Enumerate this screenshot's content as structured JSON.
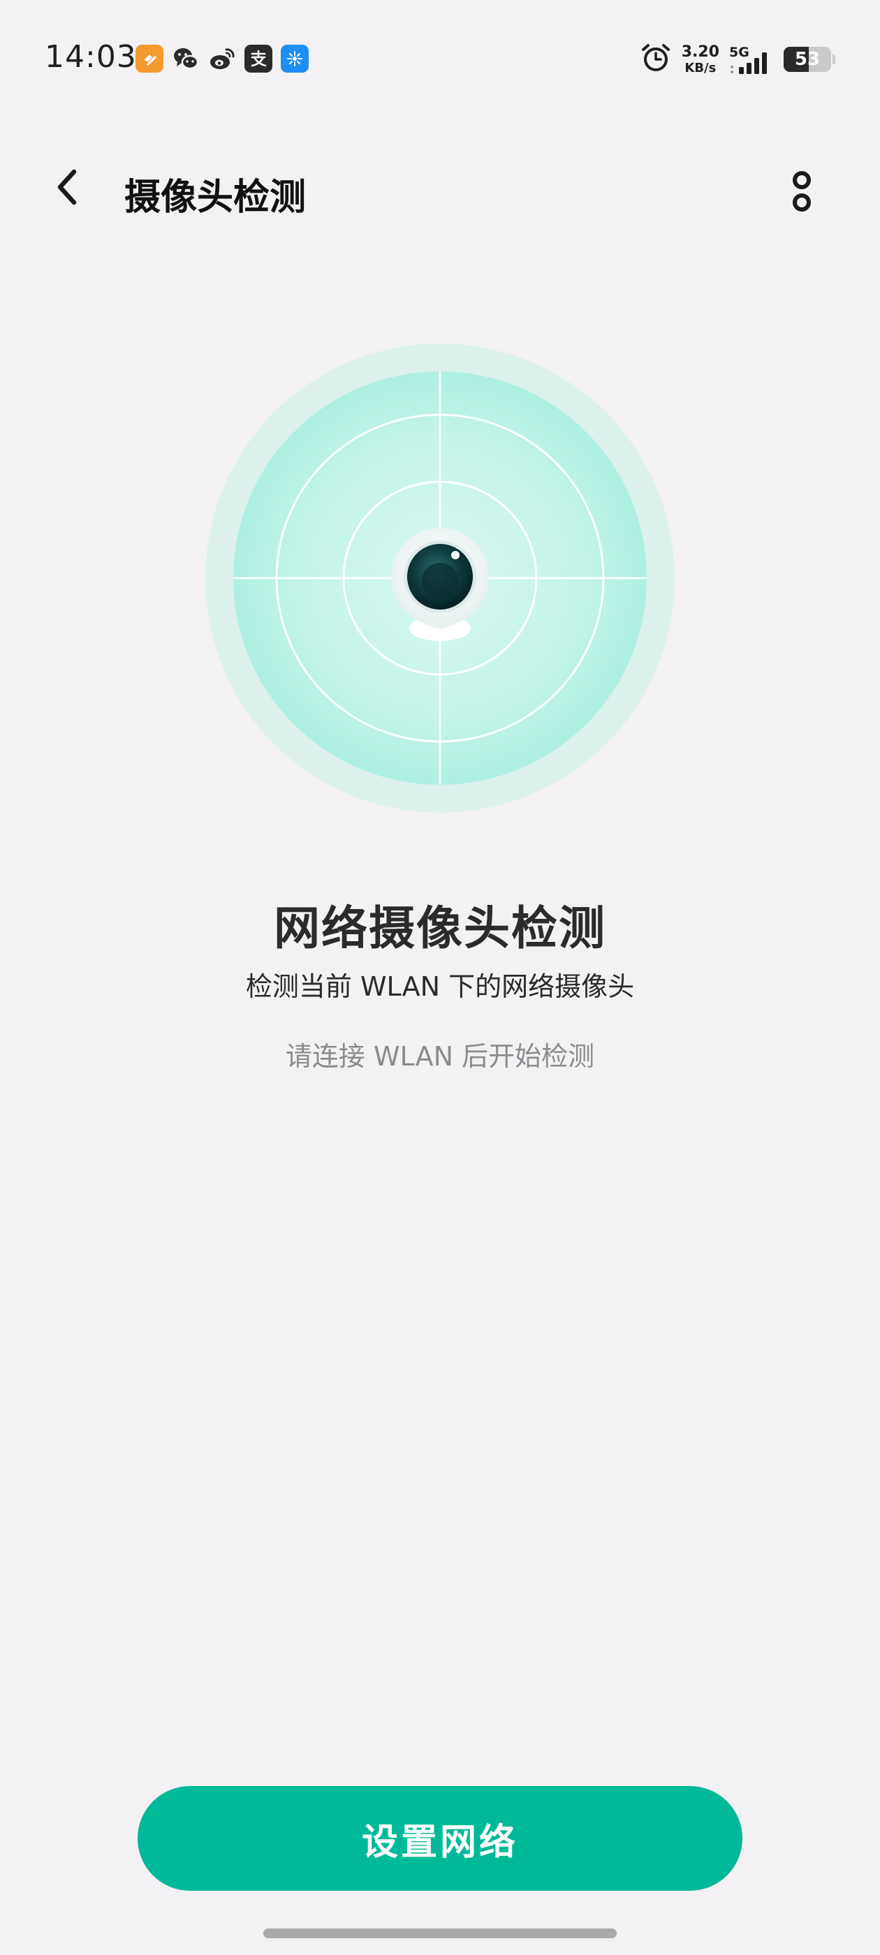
{
  "status_bar": {
    "time": "14:03",
    "net_speed_value": "3.20",
    "net_speed_unit": "KB/s",
    "network_type": "5G",
    "battery_level": "53",
    "notification_icons": [
      "orange-app-icon",
      "wechat-icon",
      "weibo-icon",
      "alipay-icon",
      "tplink-icon"
    ],
    "system_icons": [
      "alarm-icon",
      "signal-icon",
      "battery-icon"
    ]
  },
  "app_bar": {
    "title": "摄像头检测",
    "back_icon": "chevron-left-icon",
    "more_icon": "more-vertical-icon"
  },
  "main": {
    "illustration": "camera-radar",
    "heading": "网络摄像头检测",
    "description": "检测当前 WLAN 下的网络摄像头",
    "hint": "请连接 WLAN 后开始检测"
  },
  "actions": {
    "setup_network_label": "设置网络"
  },
  "colors": {
    "background": "#f3f1f4",
    "accent": "#00b998",
    "radar_outer": "#dcf1ec",
    "radar_inner": "#b4f1e4",
    "text_primary": "#2b2b2b",
    "text_hint": "#8b8b8d"
  }
}
